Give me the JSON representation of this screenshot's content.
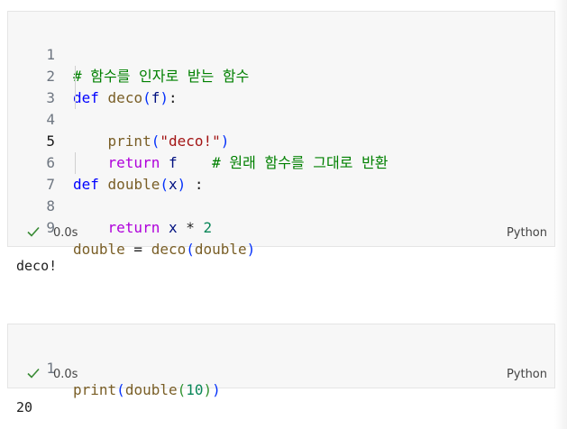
{
  "cells": [
    {
      "line_numbers": [
        "1",
        "2",
        "3",
        "4",
        "5",
        "6",
        "7",
        "8",
        "9"
      ],
      "code": {
        "l1_comment": "# 함수를 인자로 받는 함수",
        "l2_def": "def",
        "l2_name": "deco",
        "l2_open": "(",
        "l2_param": "f",
        "l2_close": ")",
        "l2_colon": ":",
        "l3_func": "print",
        "l3_open": "(",
        "l3_str": "\"deco!\"",
        "l3_close": ")",
        "l4_return": "return",
        "l4_var": "f",
        "l4_comment": "# 원래 함수를 그대로 반환",
        "l6_def": "def",
        "l6_name": "double",
        "l6_open": "(",
        "l6_param": "x",
        "l6_close": ")",
        "l6_colon": " :",
        "l7_return": "return",
        "l7_var": "x",
        "l7_op": " * ",
        "l7_num": "2",
        "l9_target": "double",
        "l9_eq": " = ",
        "l9_func": "deco",
        "l9_open": "(",
        "l9_arg": "double",
        "l9_close": ")"
      },
      "status": {
        "duration": "0.0s",
        "language": "Python"
      },
      "output": "deco!"
    },
    {
      "line_numbers": [
        "1"
      ],
      "code": {
        "l1_print": "print",
        "l1_open1": "(",
        "l1_double": "double",
        "l1_open2": "(",
        "l1_num": "10",
        "l1_close2": ")",
        "l1_close1": ")"
      },
      "status": {
        "duration": "0.0s",
        "language": "Python"
      },
      "output": "20"
    }
  ],
  "colors": {
    "keyword": "#0000ff",
    "control_keyword": "#af00db",
    "function": "#795e26",
    "string": "#a31515",
    "number": "#098658",
    "comment": "#008000",
    "success_check": "#388a34"
  },
  "icons": {
    "status_check": "check-icon"
  }
}
